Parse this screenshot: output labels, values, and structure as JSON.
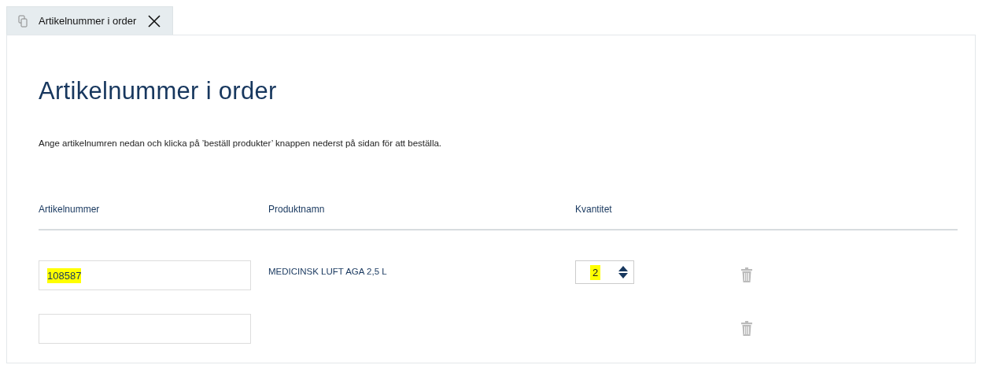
{
  "tab": {
    "label": "Artikelnummer i order",
    "selected": true
  },
  "title": "Artikelnummer i order",
  "description": "Ange artikelnumren nedan och klicka på ’beställ produkter’ knappen nederst på sidan för att beställa.",
  "table": {
    "columns": [
      "Artikelnummer",
      "Produktnamn",
      "Kvantitet"
    ],
    "rows": [
      {
        "article": "108587",
        "article_highlighted": true,
        "product": "MEDICINSK LUFT AGA 2,5 L",
        "quantity": "2",
        "quantity_highlighted": true
      },
      {
        "article_highlighted": false
      }
    ]
  }
}
